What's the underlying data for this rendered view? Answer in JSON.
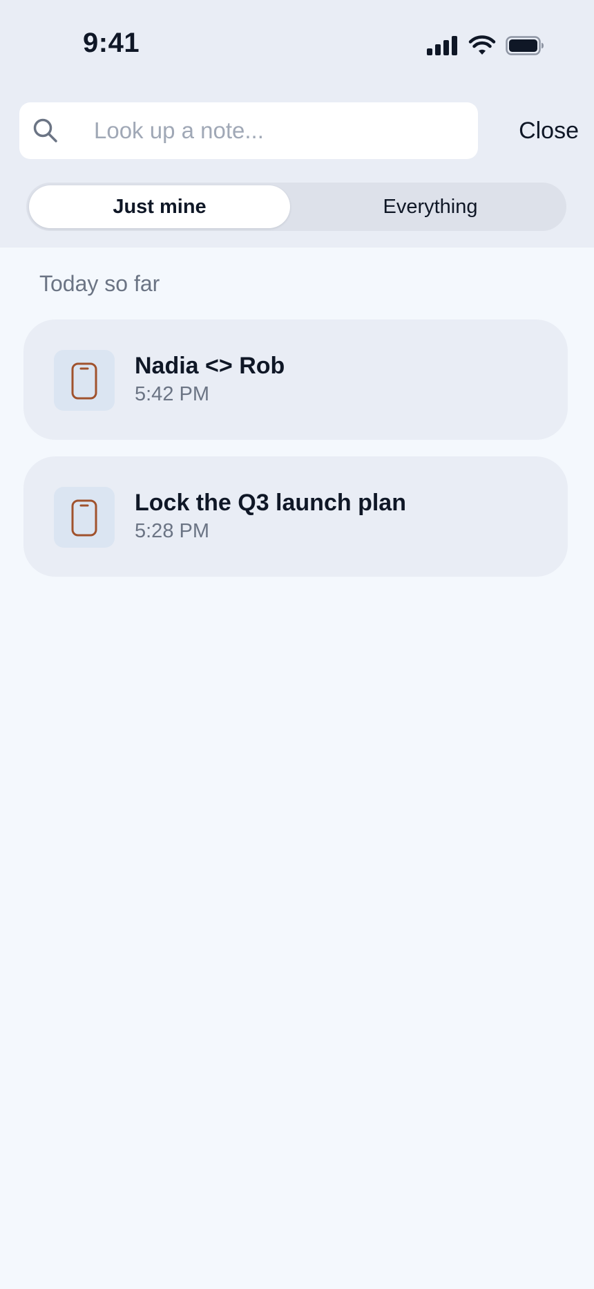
{
  "status_bar": {
    "time": "9:41",
    "icons": [
      "cellular-signal-icon",
      "wifi-icon",
      "battery-icon"
    ]
  },
  "search": {
    "placeholder": "Look up a note...",
    "value": "",
    "icon": "search-icon",
    "close_label": "Close"
  },
  "filter": {
    "options": [
      {
        "label": "Just mine",
        "selected": true
      },
      {
        "label": "Everything",
        "selected": false
      }
    ]
  },
  "section": {
    "label": "Today so far"
  },
  "notes": [
    {
      "title": "Nadia <> Rob",
      "time": "5:42 PM",
      "icon": "phone-icon"
    },
    {
      "title": "Lock the Q3 launch plan",
      "time": "5:28 PM",
      "icon": "phone-icon"
    }
  ],
  "colors": {
    "background": "#f4f8fd",
    "header_background": "#e9edf5",
    "card_background": "#e9edf5",
    "thumb_background": "#dbe5f2",
    "icon_accent": "#a0522d",
    "text_primary": "#0f1726",
    "text_secondary": "#6b7484",
    "placeholder": "#a0a8b6"
  }
}
